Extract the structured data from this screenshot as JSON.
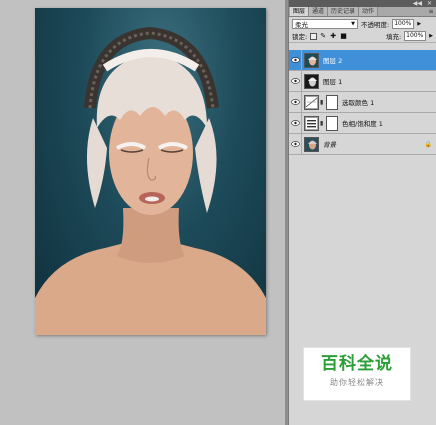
{
  "topbar": {
    "collapse": "◀◀",
    "close": "✕"
  },
  "tabs": [
    {
      "label": "图层",
      "active": true
    },
    {
      "label": "通道",
      "active": false
    },
    {
      "label": "历史记录",
      "active": false
    },
    {
      "label": "动作",
      "active": false
    }
  ],
  "tab_menu": "≡",
  "blend": {
    "mode": "柔光",
    "arrow": "▼"
  },
  "opacity": {
    "label": "不透明度:",
    "value": "100%",
    "arrow": "▶"
  },
  "lock": {
    "label": "锁定:"
  },
  "fill": {
    "label": "填充:",
    "value": "100%",
    "arrow": "▶"
  },
  "layers": [
    {
      "name": "图层 2",
      "selected": true,
      "kind": "photo"
    },
    {
      "name": "图层 1",
      "selected": false,
      "kind": "photo-dark"
    },
    {
      "name": "选取颜色 1",
      "selected": false,
      "kind": "adjustment"
    },
    {
      "name": "色相/饱和度 1",
      "selected": false,
      "kind": "adjustment"
    },
    {
      "name": "背景",
      "selected": false,
      "kind": "background",
      "lock_icon": "🔒"
    }
  ],
  "watermark": {
    "title": "百科全说",
    "subtitle": "助你轻松解决"
  },
  "colors": {
    "selection": "#3f8fd9",
    "panel": "#d6d6d6",
    "watermark_green": "#2c9e38"
  }
}
